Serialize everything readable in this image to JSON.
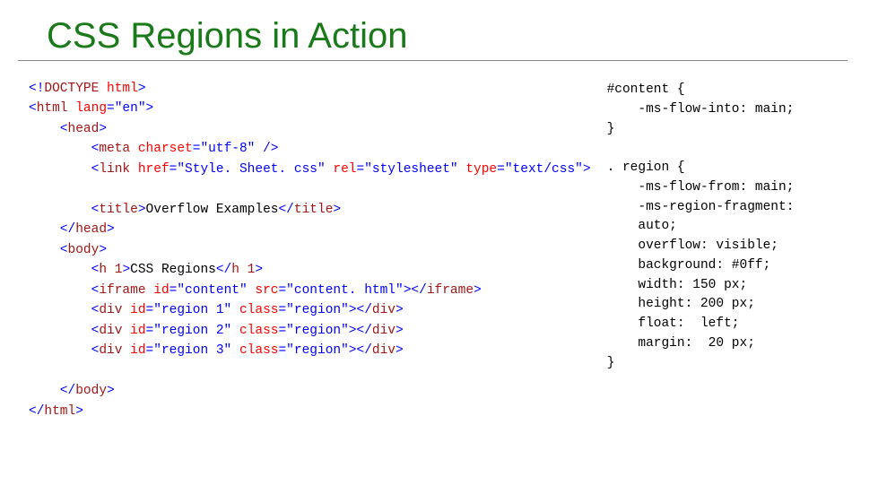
{
  "title": "CSS Regions in Action",
  "html_code": {
    "l1": {
      "a": "<!",
      "b": "DOCTYPE",
      "c": " ",
      "d": "html",
      "e": ">"
    },
    "l2": {
      "a": "<",
      "b": "html",
      "c": " ",
      "d": "lang",
      "e": "=\"en\">"
    },
    "l3": {
      "a": "    <",
      "b": "head",
      "c": ">"
    },
    "l4": {
      "a": "        <",
      "b": "meta",
      "c": " ",
      "d": "charset",
      "e": "=\"utf-8\" />"
    },
    "l5": {
      "a": "        <",
      "b": "link",
      "c": " ",
      "d": "href",
      "e": "=\"Style. Sheet. css\" ",
      "f": "rel",
      "g": "=\"stylesheet\" ",
      "h": "type",
      "i": "=\"text/css\">"
    },
    "l6": "",
    "l7": {
      "a": "        <",
      "b": "title",
      "c": ">",
      "d": "Overflow Examples",
      "e": "</",
      "f": "title",
      "g": ">"
    },
    "l8": {
      "a": "    </",
      "b": "head",
      "c": ">"
    },
    "l9": {
      "a": "    <",
      "b": "body",
      "c": ">"
    },
    "l10": {
      "a": "        <",
      "b": "h 1",
      "c": ">",
      "d": "CSS Regions",
      "e": "</",
      "f": "h 1",
      "g": ">"
    },
    "l11": {
      "a": "        <",
      "b": "iframe",
      "c": " ",
      "d": "id",
      "e": "=\"content\" ",
      "f": "src",
      "g": "=\"content. html\"></",
      "h": "iframe",
      "i": ">"
    },
    "l12": {
      "a": "        <",
      "b": "div",
      "c": " ",
      "d": "id",
      "e": "=\"region 1\" ",
      "f": "class",
      "g": "=\"region\"></",
      "h": "div",
      "i": ">"
    },
    "l13": {
      "a": "        <",
      "b": "div",
      "c": " ",
      "d": "id",
      "e": "=\"region 2\" ",
      "f": "class",
      "g": "=\"region\"></",
      "h": "div",
      "i": ">"
    },
    "l14": {
      "a": "        <",
      "b": "div",
      "c": " ",
      "d": "id",
      "e": "=\"region 3\" ",
      "f": "class",
      "g": "=\"region\"></",
      "h": "div",
      "i": ">"
    },
    "l15": "",
    "l16": {
      "a": "    </",
      "b": "body",
      "c": ">"
    },
    "l17": {
      "a": "</",
      "b": "html",
      "c": ">"
    }
  },
  "css_code": {
    "b1": {
      "sel": "#content {",
      "props": [
        "    -ms-flow-into: main;"
      ],
      "close": "}"
    },
    "b2": {
      "sel": ". region {",
      "props": [
        "    -ms-flow-from: main;",
        "    -ms-region-fragment:",
        "    auto;",
        "    overflow: visible;",
        "    background: #0ff;",
        "    width: 150 px;",
        "    height: 200 px;",
        "    float:  left;",
        "    margin:  20 px;"
      ],
      "close": "}"
    }
  }
}
